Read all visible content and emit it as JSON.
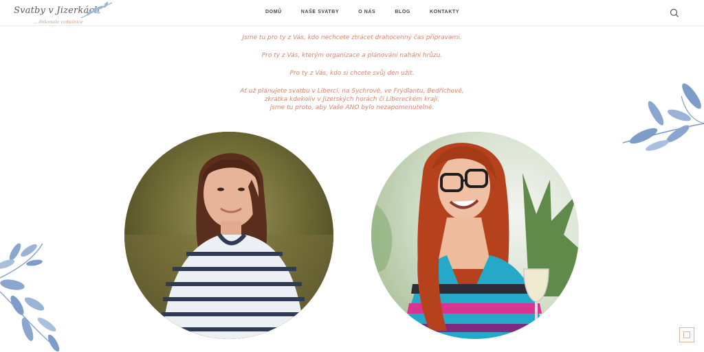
{
  "header": {
    "logo_title": "Svatby v Jizerkách",
    "logo_subtitle": "... dokonale vzdušnice",
    "nav": [
      {
        "label": "DOMŮ"
      },
      {
        "label": "NAŠE SVATBY"
      },
      {
        "label": "O NÁS"
      },
      {
        "label": "BLOG"
      },
      {
        "label": "KONTAKTY"
      }
    ],
    "search_icon": "search-icon"
  },
  "intro": {
    "p1": "Jsme tu pro ty z Vás, kdo nechcete ztrácet drahocenný čas přípravami.",
    "p2": "Pro ty z Vás, kterým organizace a plánování nahání hrůzu.",
    "p3": "Pro ty z Vás, kdo si chcete svůj den užít.",
    "p4_line1": "Ať už plánujete svatbu v Liberci, na Sychrově, ve Frýdlantu, Bedřichově,",
    "p4_line2": "zkrátka kdekoliv v Jizerských horách či Libereckém kraji,",
    "p4_line3": "jsme tu proto, aby Vaše ANO bylo nezapomenutelné."
  },
  "colors": {
    "accent_text": "#d2886b",
    "leaf": "#7d9cc7",
    "nav_text": "#444444"
  }
}
